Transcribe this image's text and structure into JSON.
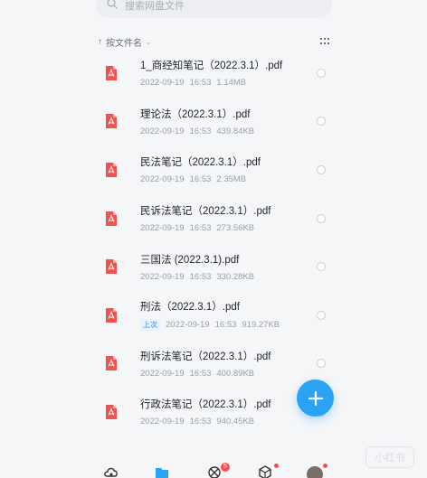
{
  "search": {
    "placeholder": "搜索网盘文件"
  },
  "sort": {
    "label": "按文件名"
  },
  "files": [
    {
      "name": "1_商经知笔记（2022.3.1）.pdf",
      "date": "2022-09-19",
      "time": "16:53",
      "size": "1.14MB",
      "badge": ""
    },
    {
      "name": "理论法（2022.3.1）.pdf",
      "date": "2022-09-19",
      "time": "16:53",
      "size": "439.84KB",
      "badge": ""
    },
    {
      "name": "民法笔记（2022.3.1）.pdf",
      "date": "2022-09-19",
      "time": "16:53",
      "size": "2.35MB",
      "badge": ""
    },
    {
      "name": "民诉法笔记（2022.3.1）.pdf",
      "date": "2022-09-19",
      "time": "16:53",
      "size": "273.56KB",
      "badge": ""
    },
    {
      "name": "三国法 (2022.3.1).pdf",
      "date": "2022-09-19",
      "time": "16:53",
      "size": "330.28KB",
      "badge": ""
    },
    {
      "name": "刑法（2022.3.1）.pdf",
      "date": "2022-09-19",
      "time": "16:53",
      "size": "919.27KB",
      "badge": "上次"
    },
    {
      "name": "刑诉法笔记（2022.3.1）.pdf",
      "date": "2022-09-19",
      "time": "16:53",
      "size": "400.89KB",
      "badge": ""
    },
    {
      "name": "行政法笔记（2022.3.1）.pdf",
      "date": "2022-09-19",
      "time": "16:53",
      "size": "940.45KB",
      "badge": ""
    }
  ],
  "nav": {
    "badge_count": "5"
  },
  "watermark": "小红书",
  "colors": {
    "accent": "#2aa3f5",
    "pdf": "#f0534f",
    "badge_red": "#ff4d4f"
  },
  "icons": [
    "search-icon",
    "sort-arrow-icon",
    "grid-view-icon",
    "pdf-file-icon",
    "plus-icon",
    "home-cloud-icon",
    "files-icon",
    "share-icon",
    "box-icon"
  ]
}
